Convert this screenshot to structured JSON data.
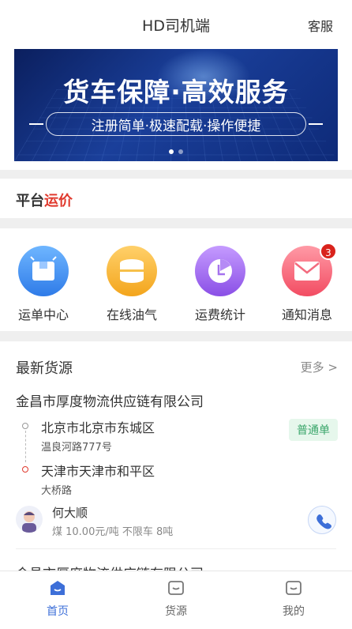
{
  "header": {
    "title": "HD司机端",
    "service": "客服"
  },
  "banner": {
    "title": "货车保障·高效服务",
    "subtitle": "注册简单·极速配载·操作便捷"
  },
  "price": {
    "title_part1": "平台",
    "title_part2": "运价"
  },
  "menu": [
    {
      "label": "运单中心",
      "icon": "waybill-box-icon"
    },
    {
      "label": "在线油气",
      "icon": "fuel-drum-icon"
    },
    {
      "label": "运费统计",
      "icon": "pie-chart-icon"
    },
    {
      "label": "通知消息",
      "icon": "mail-icon",
      "badge": "3"
    }
  ],
  "cargo": {
    "heading": "最新货源",
    "more": "更多 >",
    "company": "金昌市厚度物流供应链有限公司",
    "from_city": "北京市北京市东城区",
    "from_detail": "温良河路777号",
    "to_city": "天津市天津市和平区",
    "to_detail": "大桥路",
    "tag": "普通单",
    "driver_name": "何大顺",
    "driver_info": "煤 10.00元/吨 不限车 8吨",
    "next_company": "金昌市厚度物流供应链有限公司"
  },
  "tabs": [
    {
      "label": "首页",
      "icon": "home-icon",
      "active": true
    },
    {
      "label": "货源",
      "icon": "cargo-icon",
      "active": false
    },
    {
      "label": "我的",
      "icon": "profile-icon",
      "active": false
    }
  ],
  "colors": {
    "accent": "#3d6fd8",
    "red": "#e03a2e",
    "green": "#3ba66b"
  }
}
